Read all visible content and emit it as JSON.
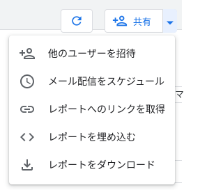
{
  "toolbar": {
    "refresh_icon": "refresh-icon",
    "share_icon": "person-add-icon",
    "share_label": "共有",
    "share_dropdown_icon": "caret-down-icon"
  },
  "background": {
    "tab_fragment": "マ"
  },
  "share_menu": {
    "items": [
      {
        "icon": "person-add-icon",
        "label": "他のユーザーを招待"
      },
      {
        "icon": "schedule-clock-icon",
        "label": "メール配信をスケジュール"
      },
      {
        "icon": "link-icon",
        "label": "レポートへのリンクを取得"
      },
      {
        "icon": "embed-code-icon",
        "label": "レポートを埋め込む"
      },
      {
        "icon": "download-icon",
        "label": "レポートをダウンロード"
      }
    ]
  },
  "colors": {
    "accent": "#1a73e8",
    "icon_gray": "#5f6368",
    "text": "#202124",
    "border": "#dadce0",
    "caret_bg": "#e8f0fe"
  }
}
